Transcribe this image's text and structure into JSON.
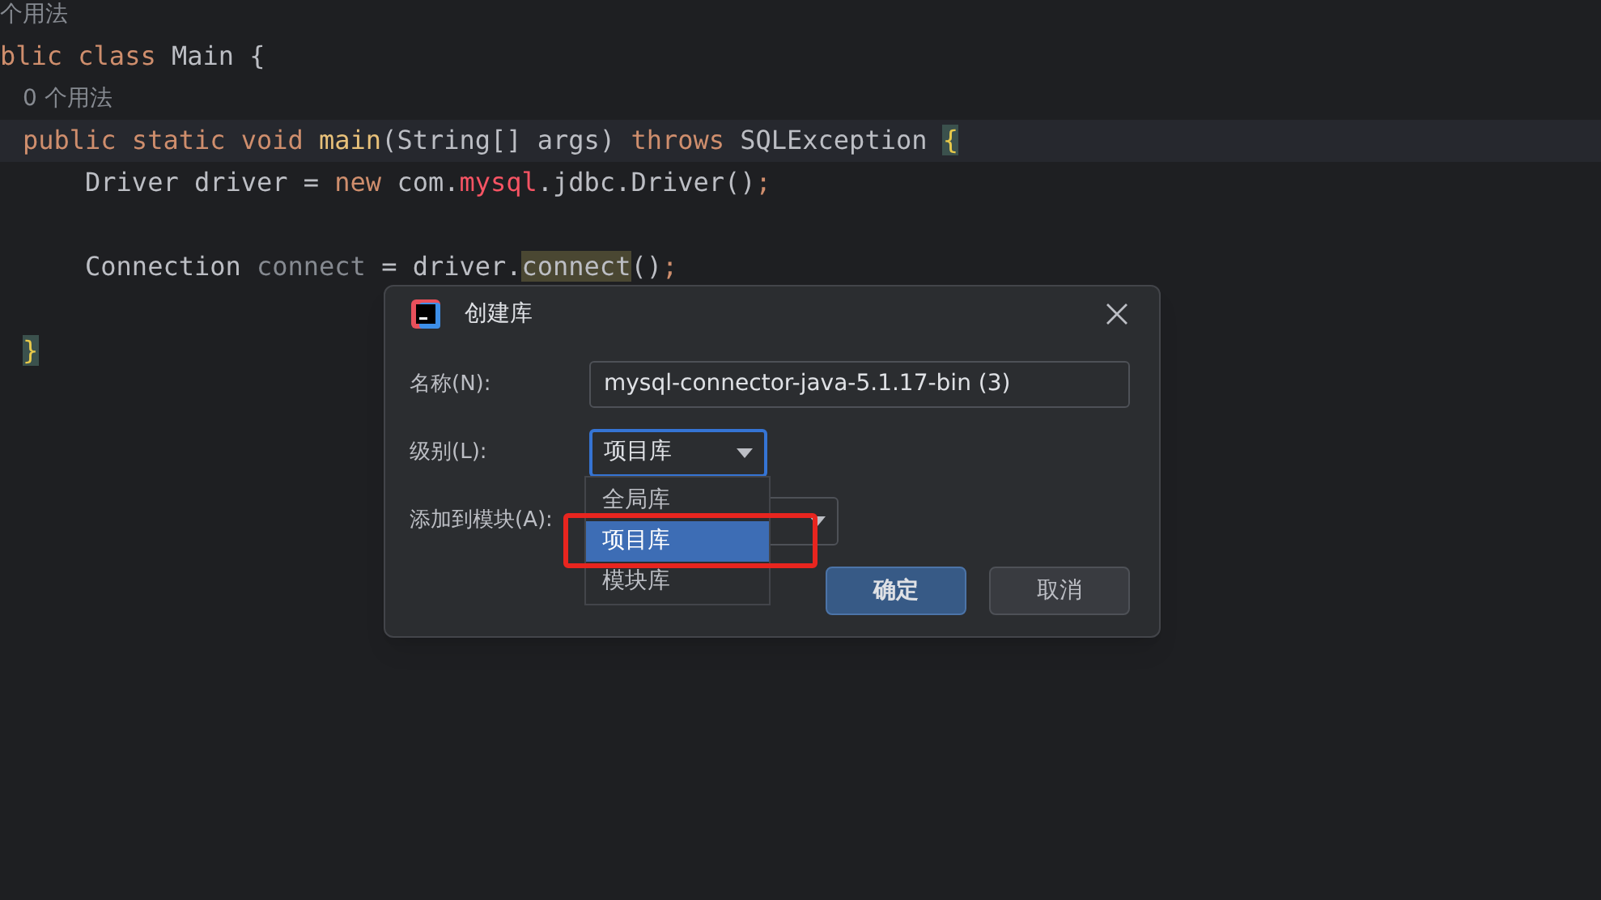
{
  "editor": {
    "lines": [
      {
        "kind": "hint",
        "outer": true,
        "current": false,
        "text": "个用法"
      },
      {
        "kind": "code",
        "outer": true,
        "current": false,
        "tokens": [
          {
            "text": "blic class ",
            "kind": "keyword"
          },
          {
            "text": "Main {",
            "kind": "plain"
          }
        ]
      },
      {
        "kind": "hint",
        "outer": false,
        "current": false,
        "text": "0 个用法"
      },
      {
        "kind": "code",
        "outer": false,
        "current": true,
        "tokens": [
          {
            "text": "public static void ",
            "kind": "keyword"
          },
          {
            "text": "main",
            "kind": "decl"
          },
          {
            "text": "(String[] args) ",
            "kind": "plain"
          },
          {
            "text": "throws ",
            "kind": "keyword"
          },
          {
            "text": "SQLException ",
            "kind": "plain"
          },
          {
            "text": "{",
            "kind": "brace"
          }
        ]
      },
      {
        "kind": "code",
        "outer": false,
        "current": false,
        "tokens": [
          {
            "text": "    Driver driver = ",
            "kind": "plain"
          },
          {
            "text": "new ",
            "kind": "keyword"
          },
          {
            "text": "com.",
            "kind": "plain"
          },
          {
            "text": "mysql",
            "kind": "error"
          },
          {
            "text": ".jdbc.Driver()",
            "kind": "plain"
          },
          {
            "text": ";",
            "kind": "keyword"
          }
        ]
      },
      {
        "kind": "blank"
      },
      {
        "kind": "code",
        "outer": false,
        "current": false,
        "tokens": [
          {
            "text": "    Connection ",
            "kind": "plain"
          },
          {
            "text": "connect",
            "kind": "unused"
          },
          {
            "text": " = driver.",
            "kind": "plain"
          },
          {
            "text": "connect",
            "kind": "match"
          },
          {
            "text": "()",
            "kind": "plain"
          },
          {
            "text": ";",
            "kind": "keyword"
          }
        ]
      },
      {
        "kind": "blank"
      },
      {
        "kind": "code",
        "outer": false,
        "current": false,
        "tokens": [
          {
            "text": "}",
            "kind": "brace"
          }
        ]
      }
    ]
  },
  "dialog": {
    "title": "创建库",
    "fields": [
      {
        "kind": "text",
        "label": "名称(N):",
        "value": "mysql-connector-java-5.1.17-bin (3)"
      },
      {
        "kind": "combo",
        "label": "级别(L):",
        "value": "项目库",
        "focused": true
      },
      {
        "kind": "combo",
        "label": "添加到模块(A):",
        "focused": false
      }
    ],
    "popup": {
      "items": [
        {
          "label": "全局库",
          "selected": false
        },
        {
          "label": "项目库",
          "selected": true
        },
        {
          "label": "模块库",
          "selected": false
        }
      ]
    },
    "buttons": [
      {
        "label": "确定",
        "primary": true
      },
      {
        "label": "取消",
        "primary": false
      }
    ]
  }
}
